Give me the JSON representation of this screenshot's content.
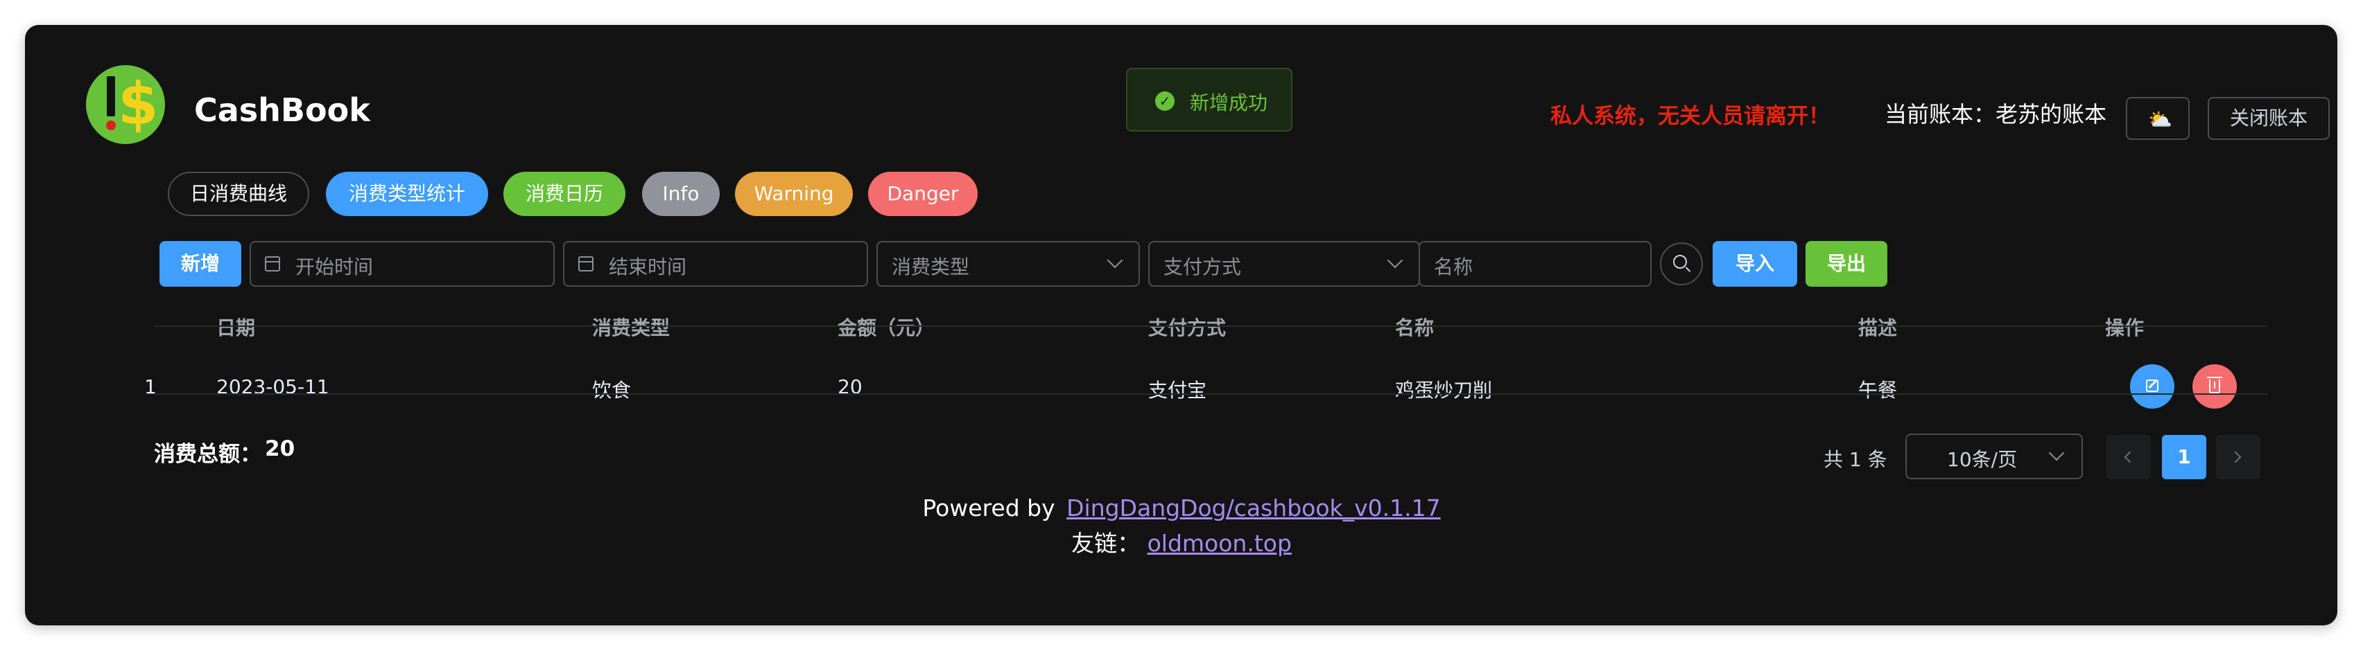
{
  "header": {
    "brand": "CashBook",
    "warning": "私人系统，无关人员请离开！",
    "account_label": "当前账本：",
    "account_name": "老苏的账本",
    "theme_icon": "cloud-sun-icon",
    "close_label": "关闭账本"
  },
  "toast": {
    "icon": "check-circle-icon",
    "message": "新增成功",
    "color": "#67c23a"
  },
  "nav": {
    "buttons": [
      {
        "label": "日消费曲线",
        "color": "#141414"
      },
      {
        "label": "消费类型统计",
        "color": "#409eff"
      },
      {
        "label": "消费日历",
        "color": "#67c23a"
      },
      {
        "label": "Info",
        "color": "#909399"
      },
      {
        "label": "Warning",
        "color": "#e6a23c"
      },
      {
        "label": "Danger",
        "color": "#f56c6c"
      }
    ]
  },
  "filters": {
    "add_label": "新增",
    "start_placeholder": "开始时间",
    "end_placeholder": "结束时间",
    "type_placeholder": "消费类型",
    "pay_placeholder": "支付方式",
    "name_placeholder": "名称",
    "search_icon": "search-icon",
    "import_label": "导入",
    "export_label": "导出"
  },
  "table": {
    "columns": [
      "日期",
      "消费类型",
      "金额（元）",
      "支付方式",
      "名称",
      "描述",
      "操作"
    ],
    "rows": [
      {
        "index": "1",
        "date": "2023-05-11",
        "type": "饮食",
        "amount": "20",
        "pay": "支付宝",
        "name": "鸡蛋炒刀削",
        "desc": "午餐"
      }
    ]
  },
  "summary": {
    "label": "消费总额：",
    "value": "20"
  },
  "pagination": {
    "total": "共 1 条",
    "page_size": "10条/页",
    "current": "1"
  },
  "footer": {
    "powered_prefix": "Powered by",
    "powered_link": "DingDangDog/cashbook_v0.1.17",
    "friend_prefix": "友链：",
    "friend_link": "oldmoon.top"
  },
  "colors": {
    "background": "#131313",
    "primary": "#409eff",
    "success": "#67c23a",
    "danger": "#f56c6c",
    "warning": "#e6a23c",
    "warning_text": "#e8230f"
  }
}
